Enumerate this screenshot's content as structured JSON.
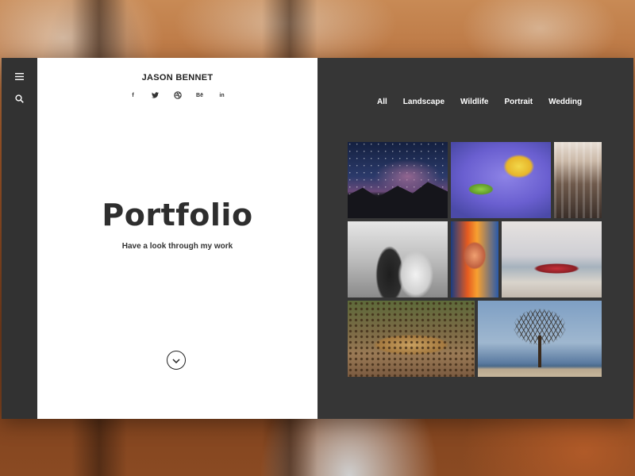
{
  "brand": {
    "name": "JASON BENNET"
  },
  "rail": {
    "menu_icon": "hamburger-menu-icon",
    "search_icon": "search-icon"
  },
  "socials": [
    {
      "label": "f",
      "icon": "facebook-icon"
    },
    {
      "label": "",
      "icon": "twitter-icon"
    },
    {
      "label": "",
      "icon": "dribbble-icon"
    },
    {
      "label": "Bē",
      "icon": "behance-icon"
    },
    {
      "label": "in",
      "icon": "linkedin-icon"
    }
  ],
  "hero": {
    "title": "Portfolio",
    "subtitle": "Have a look through my work",
    "scroll_icon": "chevron-down-icon"
  },
  "filters": [
    "All",
    "Landscape",
    "Wildlife",
    "Portrait",
    "Wedding"
  ],
  "gallery": [
    {
      "subject": "starry night sky over mountains"
    },
    {
      "subject": "green frog on purple water lily"
    },
    {
      "subject": "aerial city street"
    },
    {
      "subject": "black and white wedding couple kissing"
    },
    {
      "subject": "man with glasses against neon lights"
    },
    {
      "subject": "surfer holding red surfboard at the beach"
    },
    {
      "subject": "leopard lying on the ground"
    },
    {
      "subject": "couple under a bare tree by the sea"
    }
  ],
  "colors": {
    "rail": "#323232",
    "left_panel": "#ffffff",
    "right_panel": "#363636",
    "text_dark": "#2e2e2e"
  }
}
